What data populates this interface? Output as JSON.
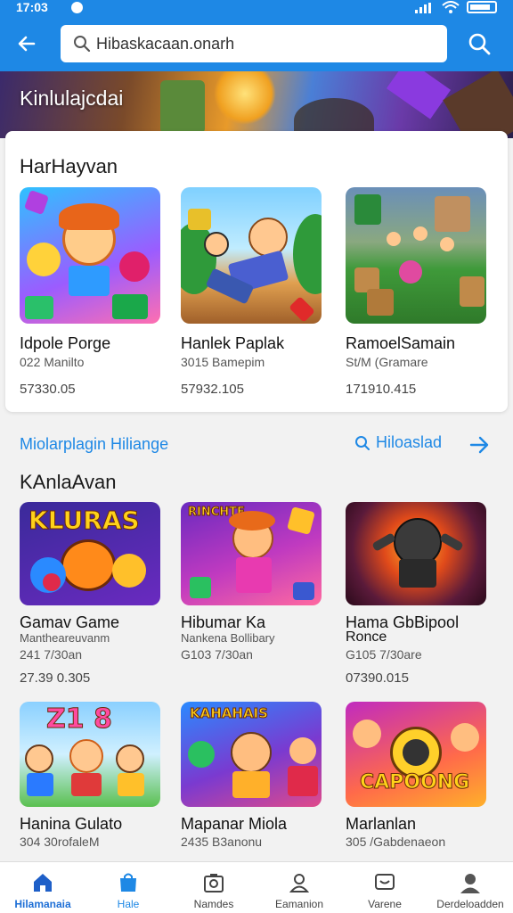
{
  "status_bar": {
    "time": "17:03"
  },
  "search": {
    "value": "Hibaskacaan.onarh"
  },
  "banner": {
    "title": "Kinlulajcdai"
  },
  "featured": {
    "title": "HarHayvan",
    "items": [
      {
        "name": "Idpole Porge",
        "sub": "022 Manilto",
        "price": "57330.05"
      },
      {
        "name": "Hanlek Paplak",
        "sub": "3015 Bamepim",
        "price": "57932.105"
      },
      {
        "name": "RamoelSamain",
        "sub": "St/M (Gramare",
        "price": "171910.415"
      }
    ]
  },
  "promo": {
    "text": "Miolarplagin Hiliange",
    "action": "Hiloaslad"
  },
  "section2": {
    "title": "KAnlaAvan",
    "items": [
      {
        "name": "Gamav Game",
        "sub": "Mantheareuvanm",
        "sub2": "241 7/30an",
        "price": "27.39 0.305",
        "art_text": "KLURAS"
      },
      {
        "name": "Hibumar Ka",
        "sub": "Nankena Bollibary",
        "sub2": "G103 7/30an",
        "price": "",
        "art_text": "RINCHTE"
      },
      {
        "name": "Hama GbBipool",
        "sub": "Ronce",
        "sub2": "G105 7/30are",
        "price": "07390.015",
        "art_text": ""
      }
    ]
  },
  "section3": {
    "items": [
      {
        "name": "Hanina Gulato",
        "sub": "304 30rofaleM",
        "art_text": "Z1 8"
      },
      {
        "name": "Mapanar Miola",
        "sub": "2435 B3anonu",
        "art_text": "KAHAHAIS"
      },
      {
        "name": "Marlanlan",
        "sub": "305 /Gabdenaeon",
        "art_text": "CAPOONG"
      }
    ]
  },
  "bottom_nav": [
    {
      "label": "Hilamanaia",
      "icon": "home-icon"
    },
    {
      "label": "Hale",
      "icon": "bag-icon"
    },
    {
      "label": "Namdes",
      "icon": "camera-icon"
    },
    {
      "label": "Eamanion",
      "icon": "people-icon"
    },
    {
      "label": "Varene",
      "icon": "message-icon"
    },
    {
      "label": "Derdeloadden",
      "icon": "profile-icon"
    }
  ],
  "colors": {
    "primary": "#1e88e5",
    "background": "#f2f2f2",
    "card": "#ffffff"
  }
}
